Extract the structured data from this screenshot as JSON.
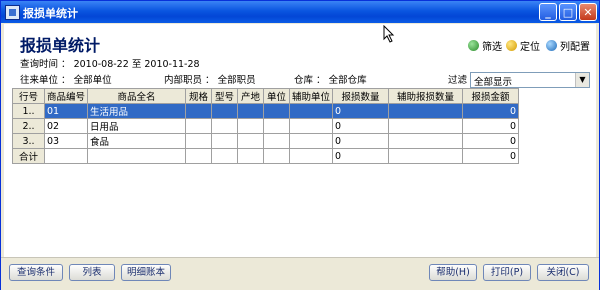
{
  "window": {
    "title": "报损单统计",
    "min_glyph": "_",
    "max_glyph": "□",
    "close_glyph": "✕"
  },
  "header": {
    "title": "报损单统计"
  },
  "toolbar": {
    "filter_label": "筛选",
    "locate_label": "定位",
    "column_config_label": "列配置"
  },
  "query": {
    "time_label": "查询时间 ：",
    "date_from": "2010-08-22",
    "to_label": "至",
    "date_to": "2010-11-28",
    "partner_label": "往来单位 ：",
    "partner_value": "全部单位",
    "staff_label": "内部职员 ：",
    "staff_value": "全部职员",
    "warehouse_label": "仓库 ：",
    "warehouse_value": "全部仓库",
    "filter_label": "过滤",
    "filter_value": "全部显示"
  },
  "table": {
    "columns": [
      "行号",
      "商品编号",
      "商品全名",
      "规格",
      "型号",
      "产地",
      "单位",
      "辅助单位",
      "报损数量",
      "辅助报损数量",
      "报损金额"
    ],
    "rows": [
      {
        "row_no": "1..",
        "code": "01",
        "name": "生活用品",
        "spec": "",
        "model": "",
        "origin": "",
        "unit": "",
        "aux_unit": "",
        "qty": "0",
        "aux_qty": "",
        "amount": "0"
      },
      {
        "row_no": "2..",
        "code": "02",
        "name": "日用品",
        "spec": "",
        "model": "",
        "origin": "",
        "unit": "",
        "aux_unit": "",
        "qty": "0",
        "aux_qty": "",
        "amount": "0"
      },
      {
        "row_no": "3..",
        "code": "03",
        "name": "食品",
        "spec": "",
        "model": "",
        "origin": "",
        "unit": "",
        "aux_unit": "",
        "qty": "0",
        "aux_qty": "",
        "amount": "0"
      }
    ],
    "total": {
      "label": "合计",
      "qty": "0",
      "amount": "0"
    }
  },
  "buttons": {
    "query_conditions": "查询条件",
    "list": "列表",
    "detail_ledger": "明细账本",
    "help": "帮助(H)",
    "print": "打印(P)",
    "close": "关闭(C)"
  },
  "colors": {
    "title_bar": "#0a55e0",
    "selection": "#316ac5",
    "heading": "#001a66"
  }
}
